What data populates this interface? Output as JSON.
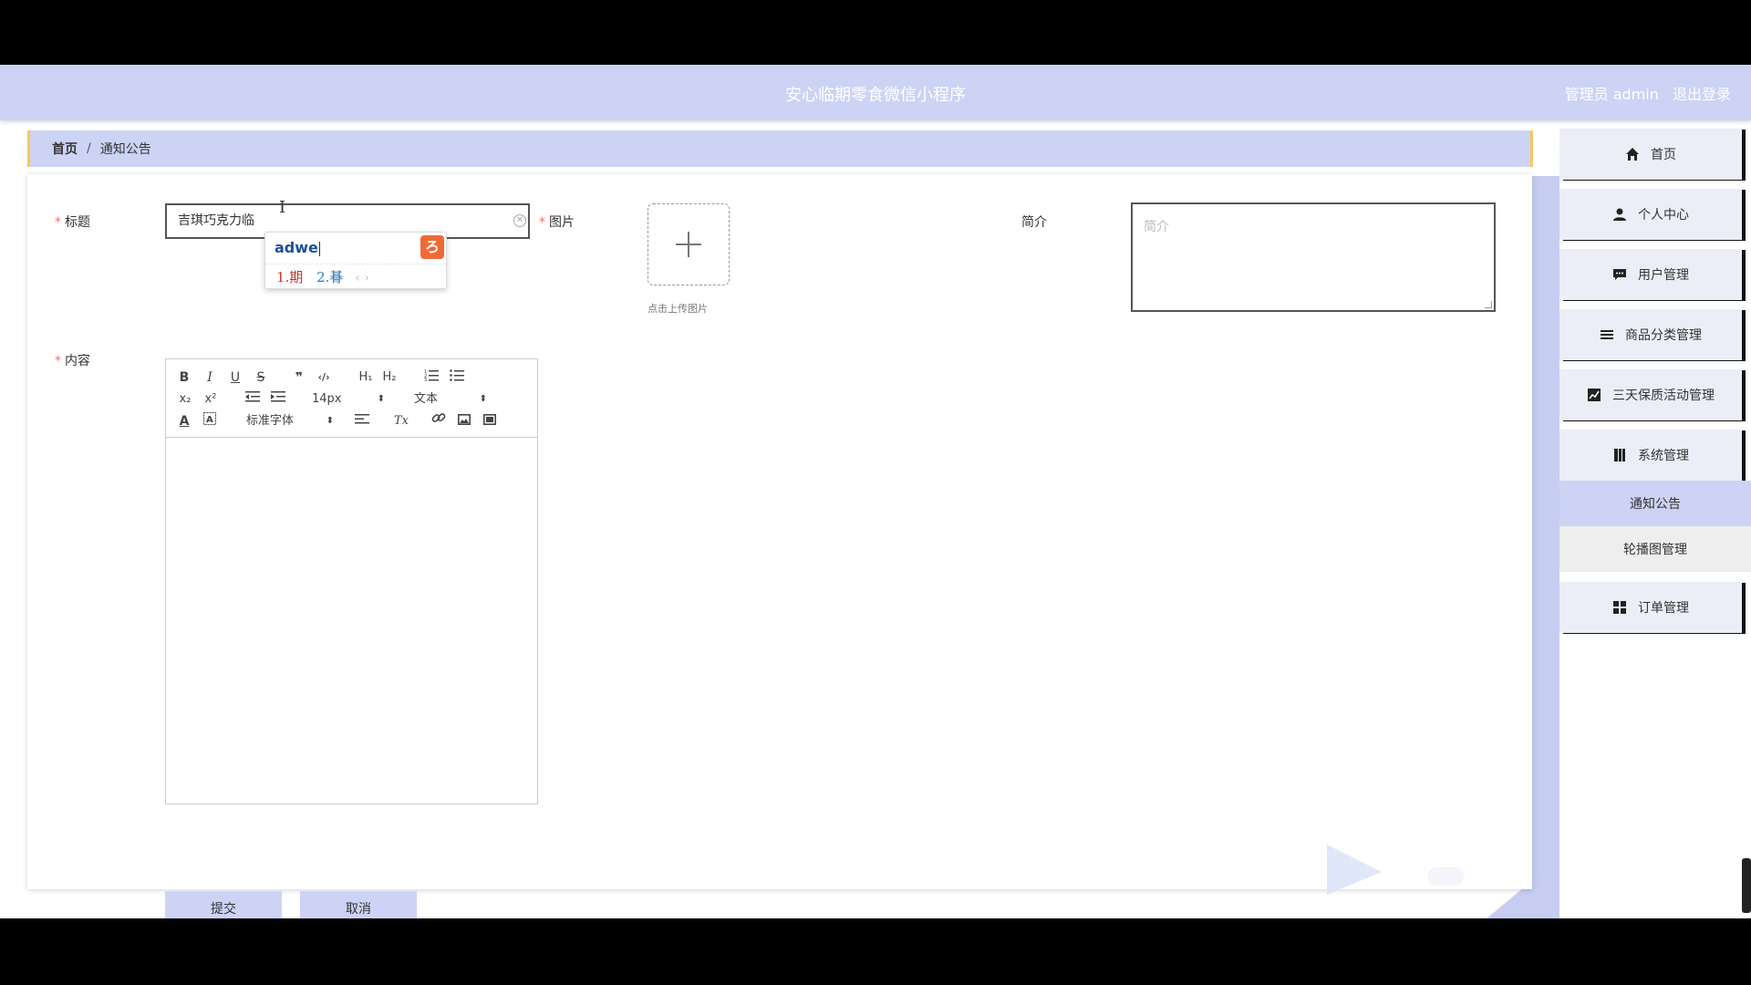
{
  "header": {
    "app_title": "安心临期零食微信小程序",
    "user_role": "管理员 admin",
    "logout": "退出登录"
  },
  "breadcrumb": {
    "home": "首页",
    "separator": "/",
    "current": "通知公告"
  },
  "form": {
    "title_label": "标题",
    "title_value": "吉琪巧克力临",
    "image_label": "图片",
    "upload_tip": "点击上传图片",
    "intro_label": "简介",
    "intro_placeholder": "简介",
    "content_label": "内容",
    "required_mark": "*"
  },
  "ime": {
    "input": "adwe",
    "logo": "ろ",
    "candidate_1": "1.期",
    "candidate_2": "2.朞",
    "arrows": "‹ ›"
  },
  "editor": {
    "bold": "B",
    "italic": "I",
    "underline": "U",
    "strike": "S",
    "quote": "❞",
    "code": "‹/›",
    "h1": "H₁",
    "h2": "H₂",
    "sub": "x₂",
    "sup": "x²",
    "font_size": "14px",
    "block_type": "文本",
    "font_family": "标准字体",
    "clean": "Tx"
  },
  "buttons": {
    "submit": "提交",
    "cancel": "取消"
  },
  "sidebar": {
    "items": [
      {
        "label": "首页",
        "icon": "home-icon"
      },
      {
        "label": "个人中心",
        "icon": "user-icon"
      },
      {
        "label": "用户管理",
        "icon": "chat-icon"
      },
      {
        "label": "商品分类管理",
        "icon": "list-icon"
      },
      {
        "label": "三天保质活动管理",
        "icon": "chart-icon"
      },
      {
        "label": "系统管理",
        "icon": "book-icon"
      }
    ],
    "sub_items": [
      {
        "label": "通知公告",
        "active": true
      },
      {
        "label": "轮播图管理",
        "active": false
      }
    ],
    "last_item": {
      "label": "订单管理",
      "icon": "grid-icon"
    }
  },
  "colors": {
    "header": "#cdd3f4",
    "accent_border": "#f6c85f",
    "required": "#f56c6c",
    "active_sub": "#cdd3f4"
  }
}
